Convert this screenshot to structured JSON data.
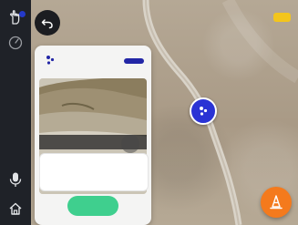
{
  "colors": {
    "rail": "#1f2228",
    "accent_blue": "#2226a6",
    "marker_blue": "#2a33d4",
    "primary_green": "#3fcf8e",
    "fab_orange": "#f47a1d",
    "indicator_yellow": "#f3c51c"
  },
  "rail": {
    "items": [
      {
        "icon": "hand-pointer-icon",
        "notification": true
      },
      {
        "icon": "timer-icon"
      },
      {
        "icon": "microphone-icon"
      },
      {
        "icon": "home-icon"
      }
    ]
  },
  "toolbar": {
    "back_icon": "undo-arrow-icon",
    "status_icon": "yellow-status-pill"
  },
  "card": {
    "header_icon": "poi-badge-icon",
    "photo": {
      "expand_icon": "expand-icon",
      "nav_icon": "photo-next-icon"
    },
    "notes_value": "",
    "primary_button_label": ""
  },
  "map": {
    "marker_icon": "poi-marker-icon",
    "fab_icon": "hazard-cone-icon"
  }
}
